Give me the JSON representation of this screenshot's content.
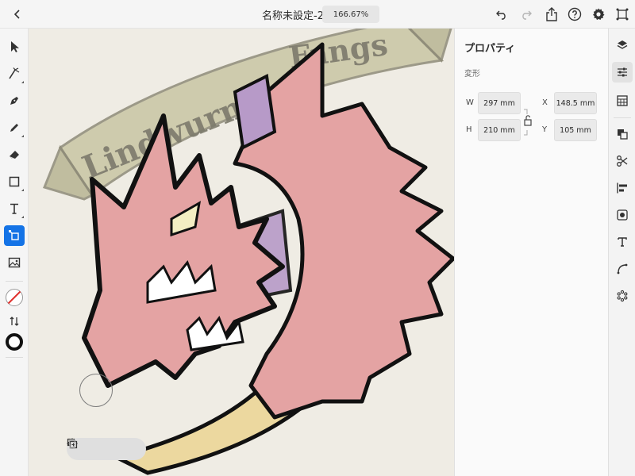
{
  "document": {
    "title": "名称未設定-2",
    "zoom": "166.67%"
  },
  "colors": {
    "accent": "#1473e6",
    "stroke_swatch": "#e0302c",
    "canvas_bg": "#efece4"
  },
  "canvas_art": {
    "banner_text": [
      "Lindwurm",
      "Fangs"
    ]
  },
  "properties": {
    "title": "プロパティ",
    "section": "変形",
    "w_label": "W",
    "w_value": "297 mm",
    "h_label": "H",
    "h_value": "210 mm",
    "x_label": "X",
    "x_value": "148.5 mm",
    "y_label": "Y",
    "y_value": "105 mm"
  },
  "left_tools": [
    "selection-tool",
    "direct-selection-tool",
    "pen-tool",
    "pencil-tool",
    "eraser-tool",
    "rectangle-tool",
    "type-tool",
    "transform-tool",
    "image-tool",
    "fill-stroke-swatch",
    "swap-icon",
    "stroke-width"
  ],
  "right_panels": [
    "layers",
    "properties",
    "grids",
    "pathfinder",
    "scissors",
    "align",
    "image-trace",
    "text",
    "curvature",
    "gear-shape"
  ]
}
